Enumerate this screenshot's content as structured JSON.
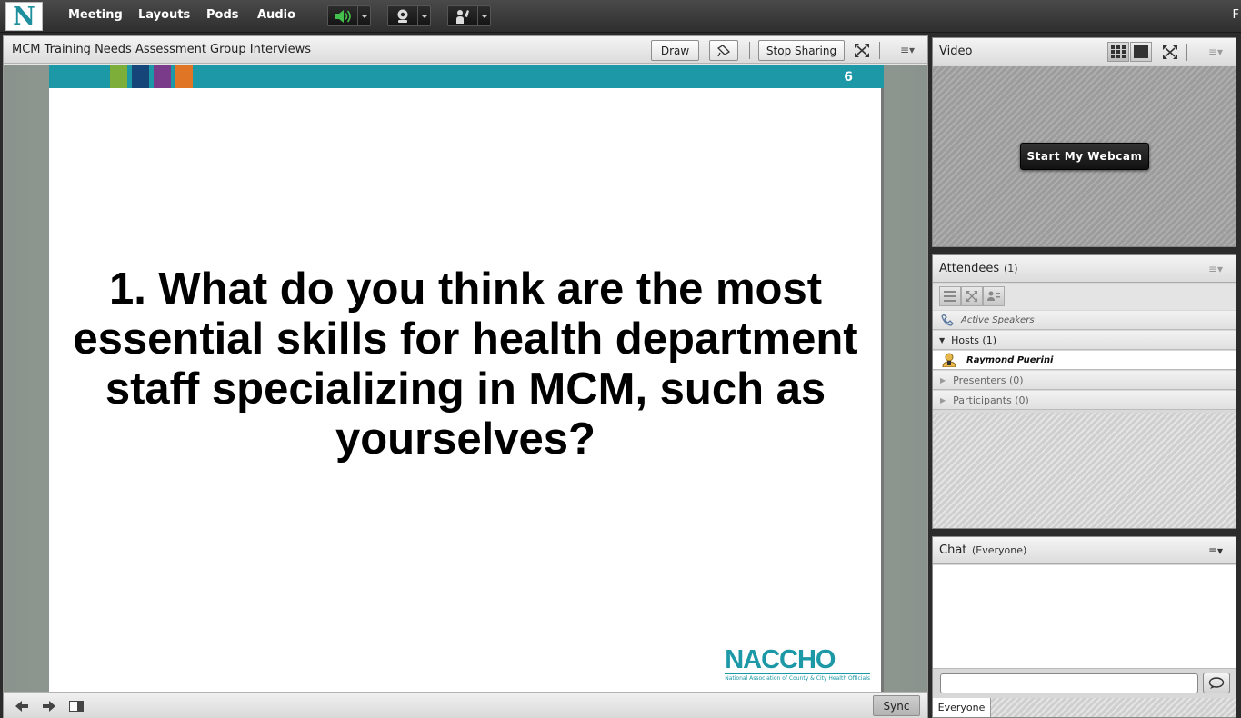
{
  "menubar": {
    "logo_letter": "N",
    "items": [
      "Meeting",
      "Layouts",
      "Pods",
      "Audio"
    ],
    "right_text": "F",
    "speaker_color": "#44c04c"
  },
  "share": {
    "title": "MCM Training Needs Assessment Group Interviews",
    "draw_label": "Draw",
    "stop_sharing_label": "Stop Sharing",
    "sync_label": "Sync"
  },
  "slide": {
    "number": "6",
    "question": "1. What do you think are the most essential skills for health department staff specializing in MCM, such as yourselves?",
    "logo_text": "NACCHO",
    "logo_subtext": "National Association of County & City Health Officials",
    "band_color": "#1c98a6",
    "bar_colors": [
      "#7dae3a",
      "#16457a",
      "#7a3b8a",
      "#e07526"
    ]
  },
  "video": {
    "title": "Video",
    "webcam_label": "Start My Webcam"
  },
  "attendees": {
    "title": "Attendees",
    "count": "(1)",
    "active_speakers": "Active Speakers",
    "hosts_label": "Hosts (1)",
    "host_name": "Raymond  Puerini",
    "presenters_label": "Presenters (0)",
    "participants_label": "Participants (0)"
  },
  "chat": {
    "title": "Chat",
    "scope": "(Everyone)",
    "input_value": "",
    "tab_label": "Everyone"
  }
}
